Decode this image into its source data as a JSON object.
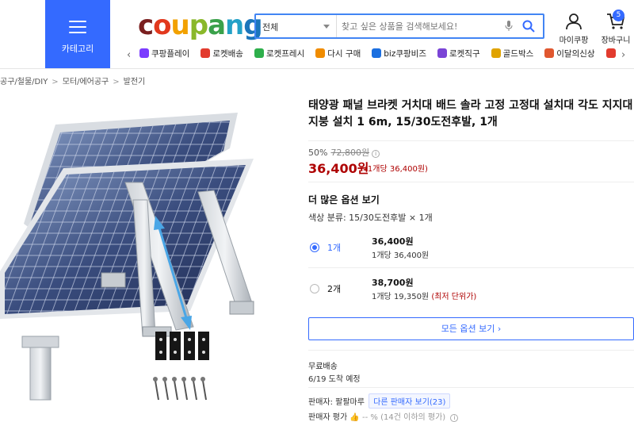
{
  "header": {
    "category_label": "카테고리",
    "logo": [
      {
        "ch": "c",
        "color": "#7a1f1f"
      },
      {
        "ch": "o",
        "color": "#e2381d"
      },
      {
        "ch": "u",
        "color": "#f2a100"
      },
      {
        "ch": "p",
        "color": "#8ab82a"
      },
      {
        "ch": "a",
        "color": "#3aa14a"
      },
      {
        "ch": "n",
        "color": "#23a1c7"
      },
      {
        "ch": "g",
        "color": "#1b75bb"
      }
    ],
    "search": {
      "category": "전체",
      "placeholder": "찾고 싶은 상품을 검색해보세요!"
    },
    "mypage_label": "마이쿠팡",
    "cart_label": "장바구니",
    "cart_count": "5",
    "nav_items": [
      {
        "label": "쿠팡플레이",
        "icon": "play-icon",
        "color": "#7b3cff"
      },
      {
        "label": "로켓배송",
        "icon": "rocket-icon",
        "color": "#e23b2e"
      },
      {
        "label": "로켓프레시",
        "icon": "rocket-fresh-icon",
        "color": "#2eaf4b"
      },
      {
        "label": "다시 구매",
        "icon": "home-icon",
        "color": "#f08c00"
      },
      {
        "label": "biz쿠팡비즈",
        "icon": "biz-icon",
        "color": "#1b6fe0"
      },
      {
        "label": "로켓직구",
        "icon": "global-icon",
        "color": "#7a44d6"
      },
      {
        "label": "골드박스",
        "icon": "goldbox-icon",
        "color": "#e0a300"
      },
      {
        "label": "이달의신상",
        "icon": "new-icon",
        "color": "#e0572f"
      },
      {
        "label": "",
        "icon": "gift-icon",
        "color": "#e23b2e"
      }
    ]
  },
  "breadcrumb": [
    "공구/철물/DIY",
    "모터/에어공구",
    "발전기"
  ],
  "breadcrumb_prefix": "",
  "product": {
    "title": "태양광 패널 브라켓 거치대 배드 솔라 고정 고정대 설치대 각도 지지대 지붕 설치 1 6m, 15/30도전후발, 1개",
    "discount": "50%",
    "original_price": "72,800원",
    "sale_price": "36,400원",
    "unit_price": "(1개당 36,400원)",
    "more_options_title": "더 많은 옵션 보기",
    "color_row": "색상 분류: 15/30도전후발 × 1개",
    "options": [
      {
        "qty": "1개",
        "price": "36,400원",
        "unit": "1개당 36,400원",
        "tag": "",
        "selected": true
      },
      {
        "qty": "2개",
        "price": "38,700원",
        "unit": "1개당 19,350원",
        "tag": "(최저 단위가)",
        "selected": false
      }
    ],
    "all_options_label": "모든 옵션 보기 ›",
    "shipping": "무료배송",
    "arrival": "6/19 도착 예정",
    "seller_label": "판매자: 팔팔마루",
    "other_sellers": "다른 판매자 보기(23)",
    "rating_label": "판매자 평가",
    "rating_value": "-- %",
    "rating_note": "(14건 이하의 평가)",
    "info_mark": "i"
  }
}
